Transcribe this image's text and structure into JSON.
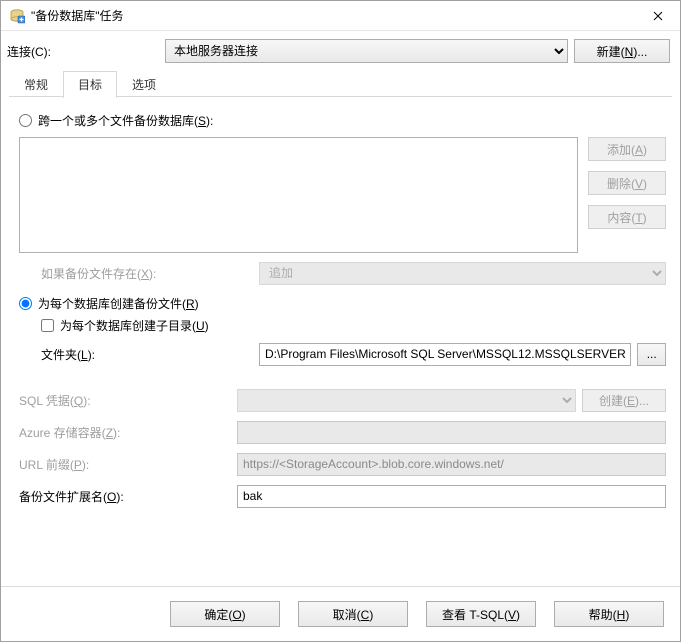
{
  "window": {
    "title": "\"备份数据库\"任务"
  },
  "connection": {
    "label": "连接(C):",
    "selected": "本地服务器连接",
    "new_btn": "新建(N)..."
  },
  "tabs": {
    "general": "常规",
    "target": "目标",
    "options": "选项"
  },
  "target_panel": {
    "multi_files_radio": "跨一个或多个文件备份数据库(S):",
    "add_btn": "添加(A)",
    "remove_btn": "删除(V)",
    "contents_btn": "内容(T)",
    "if_exists_label": "如果备份文件存在(X):",
    "if_exists_value": "追加",
    "per_db_radio": "为每个数据库创建备份文件(R)",
    "subdir_checkbox": "为每个数据库创建子目录(U)",
    "folder_label": "文件夹(L):",
    "folder_value": "D:\\Program Files\\Microsoft SQL Server\\MSSQL12.MSSQLSERVER",
    "sql_cred_label": "SQL 凭据(Q):",
    "sql_cred_create_btn": "创建(E)...",
    "azure_label": "Azure 存储容器(Z):",
    "azure_value": "",
    "url_prefix_label": "URL 前缀(P):",
    "url_prefix_value": "https://<StorageAccount>.blob.core.windows.net/",
    "ext_label": "备份文件扩展名(O):",
    "ext_value": "bak"
  },
  "footer": {
    "ok": "确定(O)",
    "cancel": "取消(C)",
    "tsql": "查看 T-SQL(V)",
    "help": "帮助(H)"
  }
}
